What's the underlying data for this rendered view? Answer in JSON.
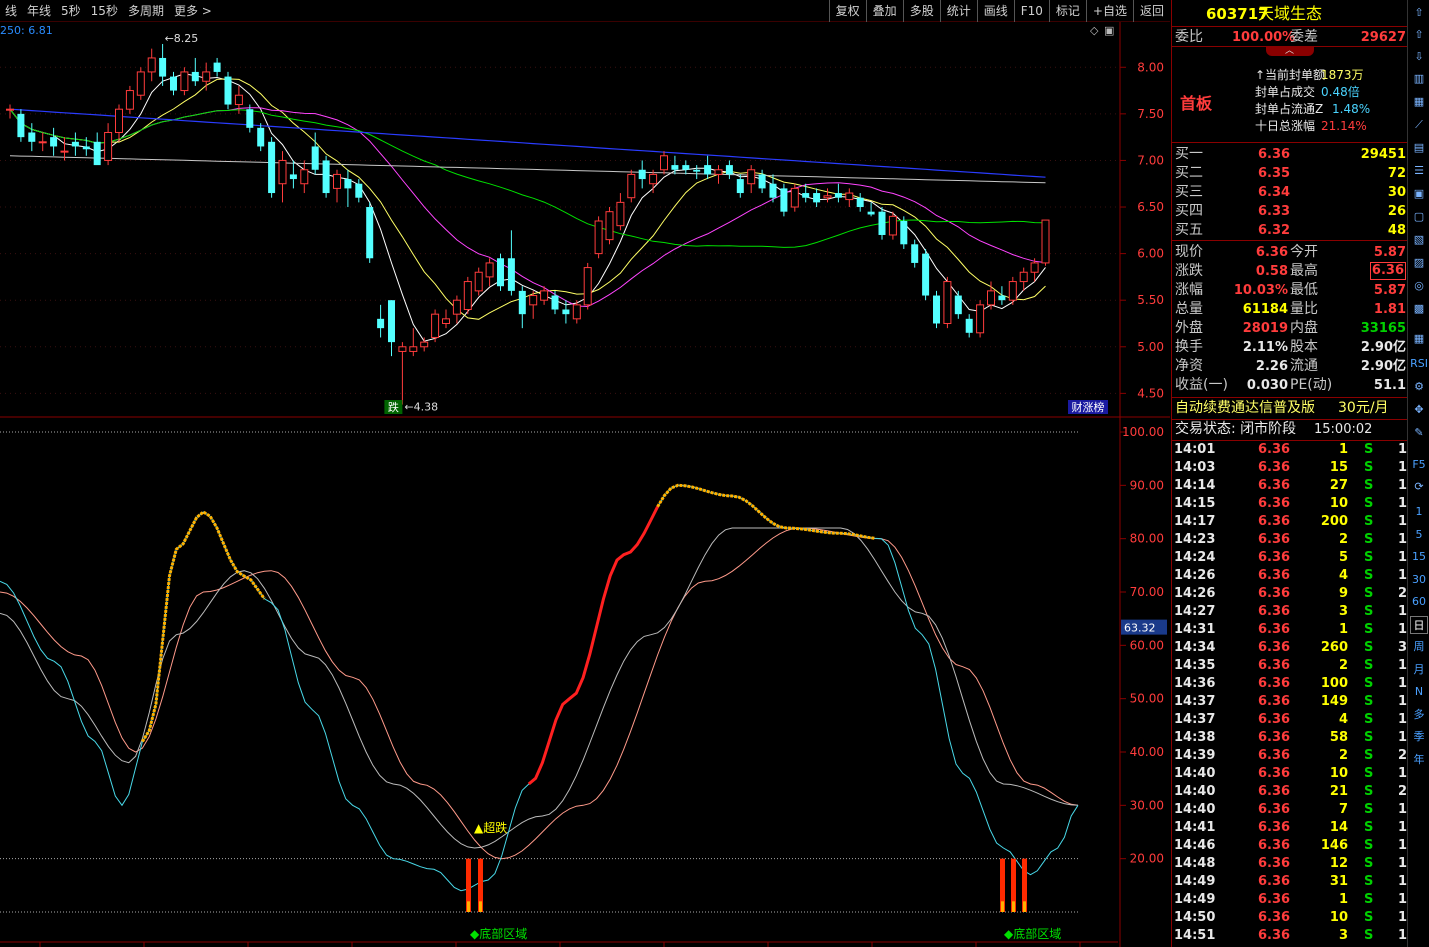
{
  "toolbar": {
    "left": [
      "线",
      "年线",
      "5秒",
      "15秒",
      "多周期",
      "更多 >"
    ],
    "right": [
      "复权",
      "叠加",
      "多股",
      "统计",
      "画线",
      "F10",
      "标记",
      "+自选",
      "返回"
    ]
  },
  "kline": {
    "ma_label": "250: 6.81",
    "y_labels": [
      "8.00",
      "7.50",
      "7.00",
      "6.50",
      "6.00",
      "5.50",
      "5.00",
      "4.50"
    ],
    "y_values": [
      8.0,
      7.5,
      7.0,
      6.5,
      6.0,
      5.5,
      5.0,
      4.5
    ],
    "high_annotation": "8.25",
    "low_annotation": "4.38",
    "low_tag": "跌",
    "corner_tag": "财涨榜"
  },
  "indicator": {
    "y_labels": [
      "100.00",
      "90.00",
      "80.00",
      "70.00",
      "60.00",
      "50.00",
      "40.00",
      "30.00",
      "20.00"
    ],
    "y_values": [
      100,
      90,
      80,
      70,
      60,
      50,
      40,
      30,
      20
    ],
    "current_value": "63.32",
    "signal_label": "▲超跌",
    "bottom_zone_1": "◆底部区域",
    "bottom_zone_2": "◆底部区域"
  },
  "chart_data": {
    "type": "candlestick",
    "price_axis_range": [
      4.3,
      8.4
    ],
    "indicator_axis_range": [
      10,
      100
    ],
    "candles": [
      [
        7.55,
        7.6,
        7.45,
        7.55
      ],
      [
        7.5,
        7.55,
        7.2,
        7.25
      ],
      [
        7.3,
        7.4,
        7.1,
        7.2
      ],
      [
        7.2,
        7.3,
        7.1,
        7.2
      ],
      [
        7.25,
        7.35,
        7.05,
        7.15
      ],
      [
        7.1,
        7.25,
        7.0,
        7.1
      ],
      [
        7.2,
        7.3,
        7.05,
        7.15
      ],
      [
        7.15,
        7.25,
        7.05,
        7.12
      ],
      [
        7.2,
        7.3,
        7.0,
        6.95
      ],
      [
        7.0,
        7.4,
        6.95,
        7.3
      ],
      [
        7.3,
        7.6,
        7.2,
        7.55
      ],
      [
        7.55,
        7.8,
        7.5,
        7.75
      ],
      [
        7.7,
        8.0,
        7.65,
        7.95
      ],
      [
        7.95,
        8.2,
        7.85,
        8.1
      ],
      [
        8.1,
        8.25,
        7.8,
        7.9
      ],
      [
        7.9,
        7.95,
        7.7,
        7.75
      ],
      [
        7.75,
        8.0,
        7.7,
        7.95
      ],
      [
        7.95,
        8.1,
        7.8,
        7.85
      ],
      [
        7.85,
        8.05,
        7.75,
        7.95
      ],
      [
        8.05,
        8.1,
        7.9,
        7.95
      ],
      [
        7.9,
        7.95,
        7.55,
        7.6
      ],
      [
        7.6,
        7.8,
        7.5,
        7.7
      ],
      [
        7.55,
        7.6,
        7.3,
        7.35
      ],
      [
        7.35,
        7.4,
        7.1,
        7.15
      ],
      [
        7.2,
        7.25,
        6.6,
        6.65
      ],
      [
        6.75,
        7.1,
        6.55,
        7.0
      ],
      [
        6.85,
        7.0,
        6.7,
        6.8
      ],
      [
        6.75,
        7.0,
        6.65,
        6.9
      ],
      [
        7.15,
        7.3,
        6.85,
        6.9
      ],
      [
        7.0,
        7.05,
        6.6,
        6.65
      ],
      [
        6.7,
        6.9,
        6.55,
        6.85
      ],
      [
        6.8,
        6.9,
        6.5,
        6.7
      ],
      [
        6.75,
        6.8,
        6.55,
        6.6
      ],
      [
        6.5,
        6.55,
        5.9,
        5.95
      ],
      [
        5.3,
        5.45,
        5.1,
        5.2
      ],
      [
        5.5,
        5.5,
        4.9,
        5.05
      ],
      [
        4.95,
        5.05,
        4.38,
        5.0
      ],
      [
        4.95,
        5.2,
        4.9,
        5.0
      ],
      [
        5.0,
        5.1,
        4.95,
        5.05
      ],
      [
        5.1,
        5.4,
        5.05,
        5.35
      ],
      [
        5.25,
        5.4,
        5.2,
        5.3
      ],
      [
        5.35,
        5.55,
        5.25,
        5.5
      ],
      [
        5.4,
        5.75,
        5.35,
        5.7
      ],
      [
        5.6,
        5.85,
        5.55,
        5.8
      ],
      [
        5.75,
        5.95,
        5.65,
        5.9
      ],
      [
        5.95,
        6.0,
        5.6,
        5.65
      ],
      [
        5.95,
        6.25,
        5.55,
        5.6
      ],
      [
        5.6,
        5.65,
        5.2,
        5.35
      ],
      [
        5.45,
        5.6,
        5.3,
        5.55
      ],
      [
        5.5,
        5.65,
        5.45,
        5.6
      ],
      [
        5.55,
        5.6,
        5.35,
        5.4
      ],
      [
        5.4,
        5.5,
        5.25,
        5.35
      ],
      [
        5.3,
        5.5,
        5.25,
        5.45
      ],
      [
        5.45,
        5.9,
        5.4,
        5.85
      ],
      [
        6.0,
        6.4,
        5.95,
        6.35
      ],
      [
        6.15,
        6.5,
        6.1,
        6.45
      ],
      [
        6.3,
        6.65,
        6.25,
        6.55
      ],
      [
        6.6,
        6.9,
        6.55,
        6.85
      ],
      [
        6.9,
        7.0,
        6.7,
        6.8
      ],
      [
        6.75,
        6.9,
        6.65,
        6.85
      ],
      [
        6.9,
        7.1,
        6.85,
        7.05
      ],
      [
        6.95,
        7.05,
        6.85,
        6.9
      ],
      [
        6.95,
        7.0,
        6.85,
        6.9
      ],
      [
        6.9,
        6.95,
        6.8,
        6.88
      ],
      [
        6.95,
        7.05,
        6.8,
        6.85
      ],
      [
        6.85,
        6.95,
        6.75,
        6.9
      ],
      [
        6.95,
        7.0,
        6.8,
        6.85
      ],
      [
        6.8,
        6.85,
        6.6,
        6.65
      ],
      [
        6.75,
        6.95,
        6.65,
        6.9
      ],
      [
        6.85,
        6.9,
        6.65,
        6.7
      ],
      [
        6.75,
        6.85,
        6.55,
        6.6
      ],
      [
        6.7,
        6.75,
        6.4,
        6.45
      ],
      [
        6.5,
        6.75,
        6.45,
        6.7
      ],
      [
        6.65,
        6.75,
        6.55,
        6.6
      ],
      [
        6.65,
        6.7,
        6.5,
        6.55
      ],
      [
        6.6,
        6.7,
        6.55,
        6.62
      ],
      [
        6.65,
        6.75,
        6.55,
        6.6
      ],
      [
        6.58,
        6.7,
        6.5,
        6.65
      ],
      [
        6.6,
        6.65,
        6.45,
        6.5
      ],
      [
        6.45,
        6.55,
        6.4,
        6.42
      ],
      [
        6.45,
        6.5,
        6.15,
        6.2
      ],
      [
        6.2,
        6.45,
        6.15,
        6.4
      ],
      [
        6.35,
        6.4,
        6.05,
        6.1
      ],
      [
        6.1,
        6.15,
        5.85,
        5.9
      ],
      [
        6.0,
        6.05,
        5.5,
        5.55
      ],
      [
        5.55,
        5.6,
        5.2,
        5.25
      ],
      [
        5.25,
        5.75,
        5.2,
        5.7
      ],
      [
        5.55,
        5.6,
        5.3,
        5.35
      ],
      [
        5.3,
        5.35,
        5.1,
        5.15
      ],
      [
        5.15,
        5.5,
        5.1,
        5.45
      ],
      [
        5.45,
        5.7,
        5.4,
        5.6
      ],
      [
        5.55,
        5.65,
        5.45,
        5.5
      ],
      [
        5.5,
        5.75,
        5.45,
        5.7
      ],
      [
        5.7,
        5.85,
        5.6,
        5.8
      ],
      [
        5.8,
        5.95,
        5.7,
        5.9
      ],
      [
        5.9,
        6.36,
        5.87,
        6.36
      ]
    ],
    "indicator_orange": [
      45,
      55,
      62,
      71,
      80,
      87,
      85,
      81,
      77,
      74,
      73,
      71,
      69
    ],
    "indicator_red": [
      17,
      18,
      24,
      30,
      33,
      34,
      34,
      33,
      32,
      33,
      36,
      43,
      49,
      57
    ],
    "indicator_cyan_end": 30
  },
  "panel": {
    "code": "603717",
    "name": "天域生态",
    "weibi_label": "委比",
    "weibi_value": "100.00%",
    "weicha_label": "委差",
    "weicha_value": "29627",
    "board_label": "首板",
    "info": [
      {
        "label": "↑当前封单额",
        "value": "1873万"
      },
      {
        "label": "封单占成交",
        "value": "0.48倍"
      },
      {
        "label": "封单占流通Z",
        "value": "1.48%"
      },
      {
        "label": "十日总涨幅",
        "value": "21.14%"
      }
    ],
    "bids": [
      {
        "label": "买一",
        "price": "6.36",
        "vol": "29451"
      },
      {
        "label": "买二",
        "price": "6.35",
        "vol": "72"
      },
      {
        "label": "买三",
        "price": "6.34",
        "vol": "30"
      },
      {
        "label": "买四",
        "price": "6.33",
        "vol": "26"
      },
      {
        "label": "买五",
        "price": "6.32",
        "vol": "48"
      }
    ],
    "stats": [
      {
        "l1": "现价",
        "v1": "6.36",
        "c1": "red",
        "l2": "今开",
        "v2": "5.87",
        "c2": "red"
      },
      {
        "l1": "涨跌",
        "v1": "0.58",
        "c1": "red",
        "l2": "最高",
        "v2": "6.36",
        "c2": "red"
      },
      {
        "l1": "涨幅",
        "v1": "10.03%",
        "c1": "red",
        "l2": "最低",
        "v2": "5.87",
        "c2": "red"
      },
      {
        "l1": "总量",
        "v1": "61184",
        "c1": "yellow",
        "l2": "量比",
        "v2": "1.81",
        "c2": "red"
      },
      {
        "l1": "外盘",
        "v1": "28019",
        "c1": "red",
        "l2": "内盘",
        "v2": "33165",
        "c2": "green"
      },
      {
        "l1": "换手",
        "v1": "2.11%",
        "c1": "white",
        "l2": "股本",
        "v2": "2.90亿",
        "c2": "white"
      },
      {
        "l1": "净资",
        "v1": "2.26",
        "c1": "white",
        "l2": "流通",
        "v2": "2.90亿",
        "c2": "white"
      },
      {
        "l1": "收益(一)",
        "v1": "0.030",
        "c1": "white",
        "l2": "PE(动)",
        "v2": "51.1",
        "c2": "white"
      }
    ],
    "promo": "自动续费通达信普及版",
    "promo_price": "30元/月",
    "trade_status": "交易状态: 闭市阶段",
    "trade_time": "15:00:02",
    "ticks": [
      {
        "t": "14:01",
        "p": "6.36",
        "v": "1",
        "s": "S",
        "n": "1"
      },
      {
        "t": "14:03",
        "p": "6.36",
        "v": "15",
        "s": "S",
        "n": "1"
      },
      {
        "t": "14:14",
        "p": "6.36",
        "v": "27",
        "s": "S",
        "n": "1"
      },
      {
        "t": "14:15",
        "p": "6.36",
        "v": "10",
        "s": "S",
        "n": "1"
      },
      {
        "t": "14:17",
        "p": "6.36",
        "v": "200",
        "s": "S",
        "n": "1"
      },
      {
        "t": "14:23",
        "p": "6.36",
        "v": "2",
        "s": "S",
        "n": "1"
      },
      {
        "t": "14:24",
        "p": "6.36",
        "v": "5",
        "s": "S",
        "n": "1"
      },
      {
        "t": "14:26",
        "p": "6.36",
        "v": "4",
        "s": "S",
        "n": "1"
      },
      {
        "t": "14:26",
        "p": "6.36",
        "v": "9",
        "s": "S",
        "n": "2"
      },
      {
        "t": "14:27",
        "p": "6.36",
        "v": "3",
        "s": "S",
        "n": "1"
      },
      {
        "t": "14:31",
        "p": "6.36",
        "v": "1",
        "s": "S",
        "n": "1"
      },
      {
        "t": "14:34",
        "p": "6.36",
        "v": "260",
        "s": "S",
        "n": "3"
      },
      {
        "t": "14:35",
        "p": "6.36",
        "v": "2",
        "s": "S",
        "n": "1"
      },
      {
        "t": "14:36",
        "p": "6.36",
        "v": "100",
        "s": "S",
        "n": "1"
      },
      {
        "t": "14:37",
        "p": "6.36",
        "v": "149",
        "s": "S",
        "n": "1"
      },
      {
        "t": "14:37",
        "p": "6.36",
        "v": "4",
        "s": "S",
        "n": "1"
      },
      {
        "t": "14:38",
        "p": "6.36",
        "v": "58",
        "s": "S",
        "n": "1"
      },
      {
        "t": "14:39",
        "p": "6.36",
        "v": "2",
        "s": "S",
        "n": "2"
      },
      {
        "t": "14:40",
        "p": "6.36",
        "v": "10",
        "s": "S",
        "n": "1"
      },
      {
        "t": "14:40",
        "p": "6.36",
        "v": "21",
        "s": "S",
        "n": "2"
      },
      {
        "t": "14:40",
        "p": "6.36",
        "v": "7",
        "s": "S",
        "n": "1"
      },
      {
        "t": "14:41",
        "p": "6.36",
        "v": "14",
        "s": "S",
        "n": "1"
      },
      {
        "t": "14:46",
        "p": "6.36",
        "v": "146",
        "s": "S",
        "n": "1"
      },
      {
        "t": "14:48",
        "p": "6.36",
        "v": "12",
        "s": "S",
        "n": "1"
      },
      {
        "t": "14:49",
        "p": "6.36",
        "v": "31",
        "s": "S",
        "n": "1"
      },
      {
        "t": "14:49",
        "p": "6.36",
        "v": "1",
        "s": "S",
        "n": "1"
      },
      {
        "t": "14:50",
        "p": "6.36",
        "v": "10",
        "s": "S",
        "n": "1"
      },
      {
        "t": "14:51",
        "p": "6.36",
        "v": "3",
        "s": "S",
        "n": "1"
      }
    ]
  },
  "side_icons": {
    "periods": [
      "1",
      "5",
      "15",
      "30",
      "60",
      "日",
      "周",
      "月",
      "N",
      "多",
      "季",
      "年"
    ],
    "text_icons": [
      "RSI",
      "F5"
    ]
  },
  "colors": {
    "up": "#ff3c3c",
    "down": "#54ffff",
    "ma5": "#ffffff",
    "ma10": "#ffff66",
    "ma20": "#ff44ff",
    "ma60": "#00e000",
    "ma120": "#2a3cff",
    "ma250": "#c8c8c8"
  }
}
